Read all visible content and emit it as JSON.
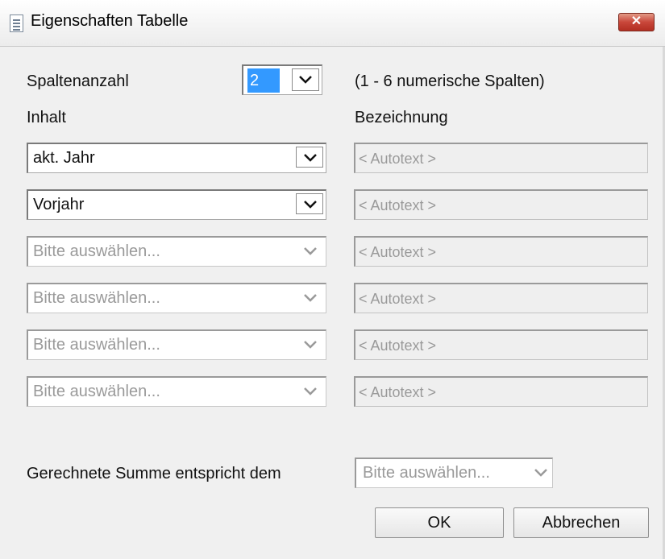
{
  "window": {
    "title": "Eigenschaften Tabelle",
    "close_label": "✕"
  },
  "spaltenanzahl": {
    "label": "Spaltenanzahl",
    "value": "2",
    "hint": "(1 - 6 numerische Spalten)"
  },
  "headers": {
    "inhalt": "Inhalt",
    "bezeichnung": "Bezeichnung"
  },
  "rows": [
    {
      "inhalt": "akt. Jahr",
      "enabled": true,
      "bezeichnung": "< Autotext >"
    },
    {
      "inhalt": "Vorjahr",
      "enabled": true,
      "bezeichnung": "< Autotext >"
    },
    {
      "inhalt": "Bitte auswählen...",
      "enabled": false,
      "bezeichnung": "< Autotext >"
    },
    {
      "inhalt": "Bitte auswählen...",
      "enabled": false,
      "bezeichnung": "< Autotext >"
    },
    {
      "inhalt": "Bitte auswählen...",
      "enabled": false,
      "bezeichnung": "< Autotext >"
    },
    {
      "inhalt": "Bitte auswählen...",
      "enabled": false,
      "bezeichnung": "< Autotext >"
    }
  ],
  "summe": {
    "label": "Gerechnete Summe entspricht dem",
    "value": "Bitte auswählen..."
  },
  "buttons": {
    "ok": "OK",
    "cancel": "Abbrechen"
  },
  "colors": {
    "selection": "#3399ff",
    "close_button": "#c9463a",
    "disabled_text": "#9a9a9a"
  },
  "icons": [
    "document-icon",
    "close-icon",
    "chevron-down-icon"
  ]
}
